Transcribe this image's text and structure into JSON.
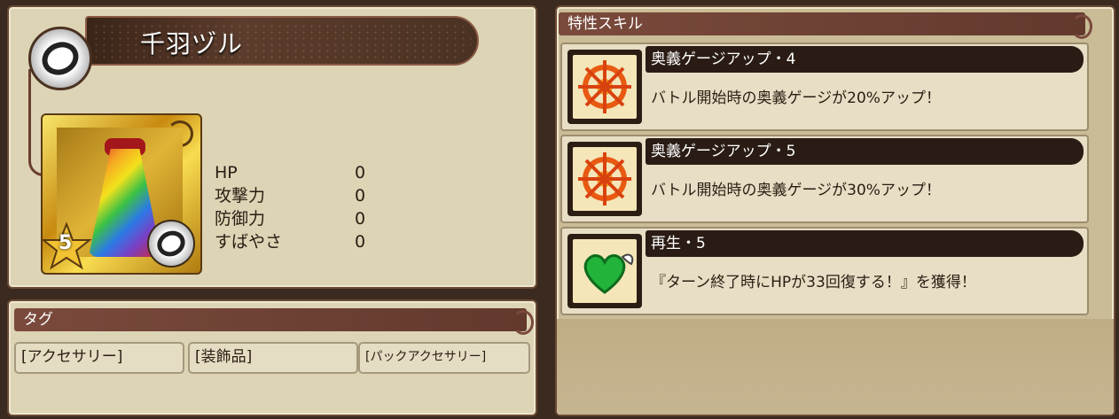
{
  "item": {
    "name": "千羽ヅル",
    "rarity": "5",
    "icons": {
      "badge": "ring-icon",
      "card_badge": "ring-icon"
    }
  },
  "stats": [
    {
      "label": "HP",
      "value": "0"
    },
    {
      "label": "攻撃力",
      "value": "0"
    },
    {
      "label": "防御力",
      "value": "0"
    },
    {
      "label": "すばやさ",
      "value": "0"
    }
  ],
  "tags": {
    "header": "タグ",
    "items": [
      "[アクセサリー]",
      "[装飾品]",
      "[パックアクセサリー]"
    ]
  },
  "skills": {
    "header": "特性スキル",
    "items": [
      {
        "title": "奥義ゲージアップ・4",
        "description": "バトル開始時の奥義ゲージが20%アップ！",
        "icon": "sun-target-icon"
      },
      {
        "title": "奥義ゲージアップ・5",
        "description": "バトル開始時の奥義ゲージが30%アップ！",
        "icon": "sun-target-icon"
      },
      {
        "title": "再生・5",
        "description": "『ターン終了時にHPが33回復する！』を獲得！",
        "icon": "winged-heart-icon"
      }
    ]
  },
  "colors": {
    "header_bar": "#7a4a3c",
    "panel": "#ddd4b6",
    "title_bar": "#2a1c14"
  }
}
